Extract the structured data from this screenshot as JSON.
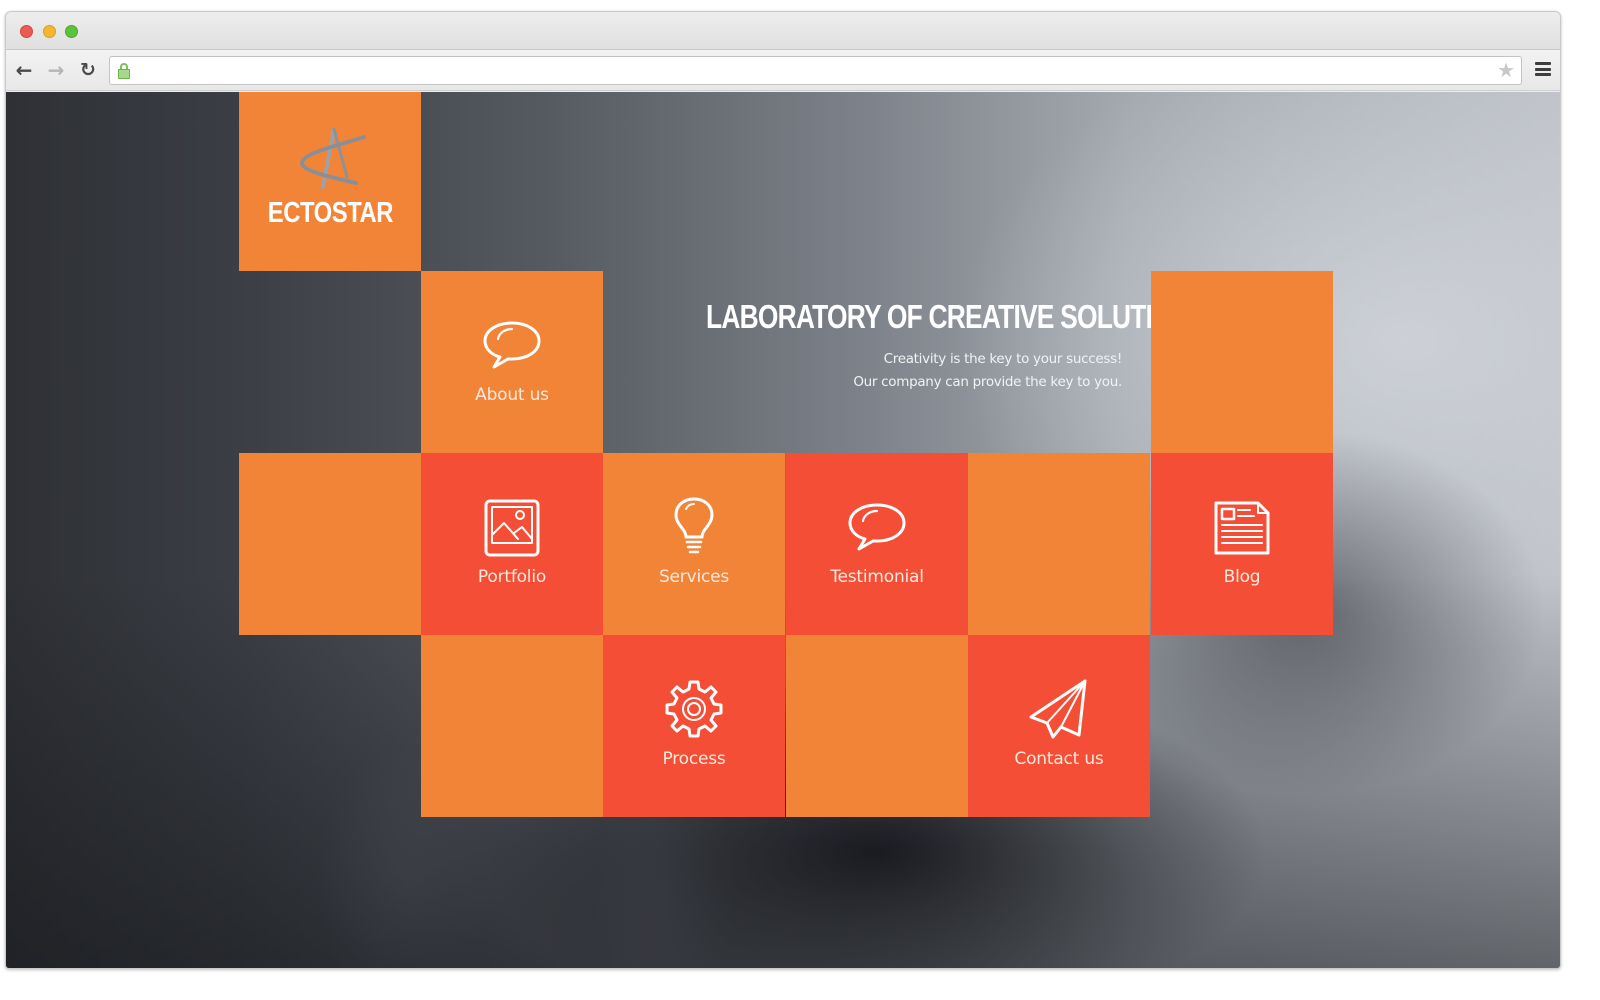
{
  "browser": {
    "url": "",
    "controls": {
      "back": "back-arrow",
      "forward": "forward-arrow",
      "reload": "reload",
      "secure": "lock",
      "bookmark": "star",
      "menu": "hamburger"
    }
  },
  "site": {
    "brand": "ECTOSTAR",
    "hero": {
      "title": "LABORATORY OF CREATIVE SOLUTIONS",
      "subtitle_line1": "Creativity is the key to your success!",
      "subtitle_line2": "Our company can provide the key to you."
    },
    "colors": {
      "orange": "#F28438",
      "red": "#F44F36"
    },
    "nav_tiles": [
      {
        "label": "About us",
        "icon": "speech-bubble"
      },
      {
        "label": "Portfolio",
        "icon": "picture-frame"
      },
      {
        "label": "Services",
        "icon": "light-bulb"
      },
      {
        "label": "Testimonial",
        "icon": "speech-bubble"
      },
      {
        "label": "Blog",
        "icon": "newspaper"
      },
      {
        "label": "Process",
        "icon": "gear"
      },
      {
        "label": "Contact us",
        "icon": "paper-plane"
      }
    ]
  }
}
